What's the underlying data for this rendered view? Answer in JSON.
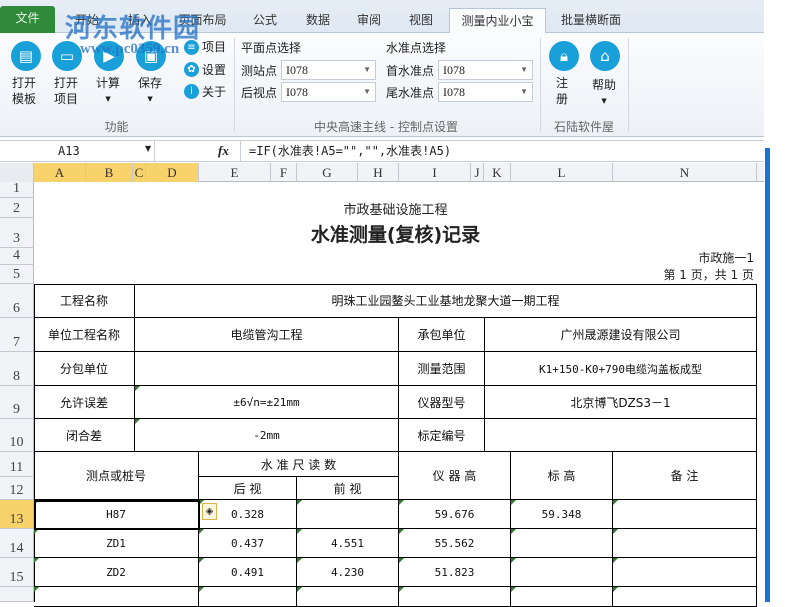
{
  "watermark": {
    "title": "河东软件园",
    "url": "www.pc0359.cn"
  },
  "tabs": [
    "文件",
    "开始",
    "插入",
    "页面布局",
    "公式",
    "数据",
    "审阅",
    "视图",
    "测量内业小宝",
    "批量横断面"
  ],
  "ribbon": {
    "func": {
      "open_template": [
        "打开",
        "模板"
      ],
      "open_project": [
        "打开",
        "项目"
      ],
      "calc": "计算",
      "save": "保存",
      "project": "项目",
      "settings": "设置",
      "about": "关于",
      "group": "功能"
    },
    "plane": {
      "title": "平面点选择",
      "station_label": "测站点",
      "station_value": "I078",
      "back_label": "后视点",
      "back_value": "I078"
    },
    "level": {
      "title": "水准点选择",
      "first_label": "首水准点",
      "first_value": "I078",
      "last_label": "尾水准点",
      "last_value": "I078"
    },
    "control_group": "中央高速主线 - 控制点设置",
    "soft": {
      "register": [
        "注",
        "册"
      ],
      "help": "帮助",
      "group": "石陆软件屋"
    }
  },
  "formula_bar": {
    "name_box": "A13",
    "fx": "fx",
    "formula": "=IF(水准表!A5=\"\",\"\",水准表!A5)"
  },
  "columns": [
    "A",
    "B",
    "C",
    "D",
    "E",
    "F",
    "G",
    "H",
    "I",
    "J",
    "K",
    "L",
    "N"
  ],
  "rows": [
    "1",
    "2",
    "3",
    "4",
    "5",
    "6",
    "7",
    "8",
    "9",
    "10",
    "11",
    "12",
    "13",
    "14",
    "15"
  ],
  "sheet": {
    "subtitle": "市政基础设施工程",
    "title": "水准测量(复核)记录",
    "form_no": "市政施一1",
    "page": "第 1 页，共 1 页",
    "info": {
      "project_label": "工程名称",
      "project": "明珠工业园鳌头工业基地龙聚大道一期工程",
      "unit_label": "单位工程名称",
      "unit": "电缆管沟工程",
      "contractor_label": "承包单位",
      "contractor": "广州晟源建设有限公司",
      "sub_label": "分包单位",
      "sub": "",
      "range_label": "测量范围",
      "range": "K1+150-K0+790电缆沟盖板成型",
      "tolerance_label": "允许误差",
      "tolerance": "±6√n=±21mm",
      "instrument_label": "仪器型号",
      "instrument": "北京博飞DZS3－1",
      "closure_label": "闭合差",
      "closure": "-2mm",
      "calib_label": "标定编号",
      "calib": ""
    },
    "headers": {
      "point": "测点或桩号",
      "reading": "水 准 尺 读 数",
      "back": "后 视",
      "front": "前 视",
      "inst_h": "仪 器 高",
      "elev": "标  高",
      "remark": "备  注"
    },
    "data": [
      [
        "H87",
        "0.328",
        "",
        "59.676",
        "59.348",
        ""
      ],
      [
        "ZD1",
        "0.437",
        "4.551",
        "55.562",
        "",
        ""
      ],
      [
        "ZD2",
        "0.491",
        "4.230",
        "51.823",
        "",
        ""
      ]
    ]
  }
}
